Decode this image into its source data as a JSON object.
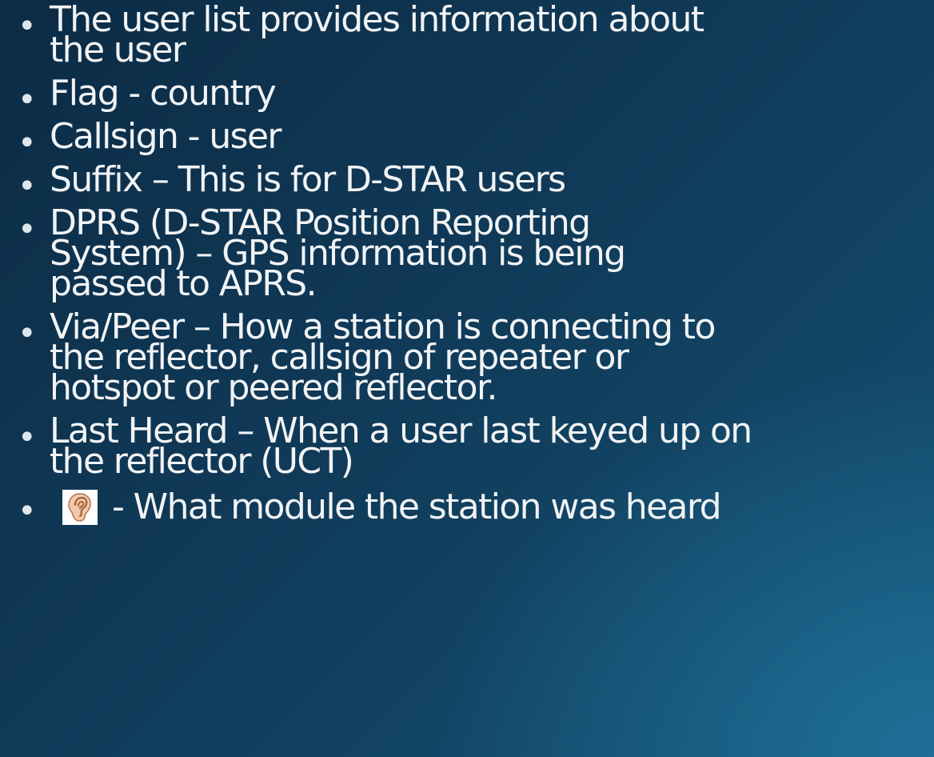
{
  "bullets": [
    {
      "id": "user-list",
      "lines": [
        "The user list provides information about",
        "the user"
      ]
    },
    {
      "id": "flag",
      "lines": [
        "Flag - country"
      ]
    },
    {
      "id": "callsign",
      "lines": [
        "Callsign - user"
      ]
    },
    {
      "id": "suffix",
      "lines": [
        "Suffix – This is for D-STAR users"
      ]
    },
    {
      "id": "dprs",
      "lines": [
        "DPRS (D-STAR Position Reporting",
        "System) – GPS information is being",
        "passed to APRS."
      ]
    },
    {
      "id": "via-peer",
      "lines": [
        "Via/Peer – How a station is connecting to",
        "the reflector, callsign of repeater or",
        "hotspot or peered reflector."
      ]
    },
    {
      "id": "last-heard",
      "lines": [
        "Last Heard – When a user last keyed up on",
        "the reflector (UCT)"
      ]
    },
    {
      "id": "module",
      "icon": "ear-icon",
      "lines": [
        "- What module the station was heard"
      ]
    }
  ],
  "colors": {
    "background_dark": "#0c2b45",
    "background_light": "#1f6f97",
    "text": "#f1f3f5",
    "ear_skin": "#f2c9a8"
  }
}
